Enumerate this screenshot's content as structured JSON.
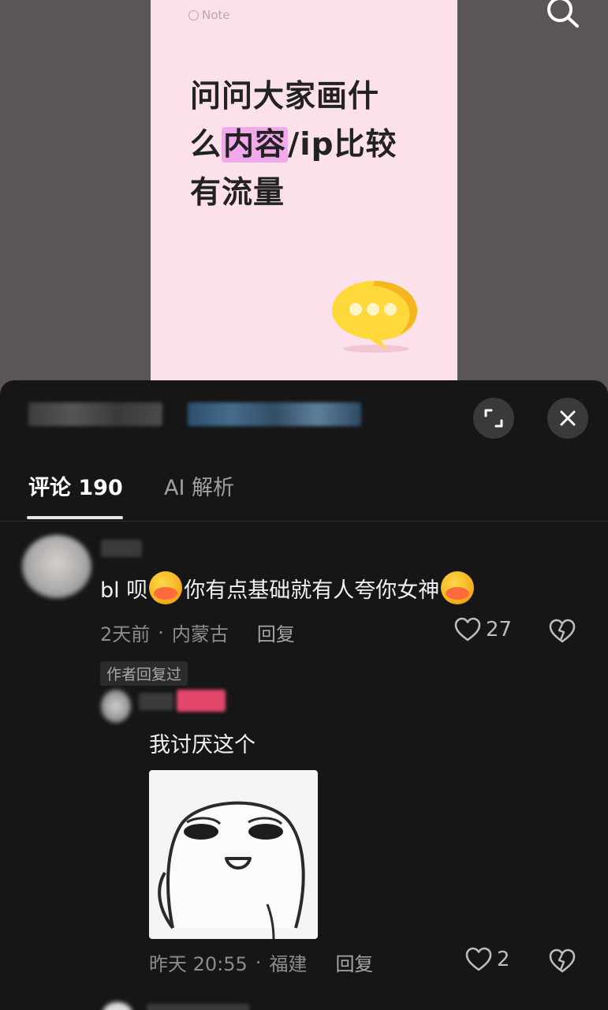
{
  "preview": {
    "note_tag": "Note",
    "title_line1": "问问大家画什",
    "title_line2_pre": "么",
    "title_line2_hl": "内容",
    "title_line2_post": "/ip比较",
    "title_line3": "有流量"
  },
  "tabs": {
    "comments": "评论 190",
    "ai": "AI 解析"
  },
  "comments": [
    {
      "text_1": "bl 呗",
      "text_2": "你有点基础就有人夸你女神",
      "time": "2天前",
      "location": "内蒙古",
      "reply": "回复",
      "likes": "27",
      "author_tag": "作者回复过"
    }
  ],
  "reply": {
    "text": "我讨厌这个",
    "time": "昨天 20:55",
    "location": "福建",
    "reply": "回复",
    "likes": "2"
  },
  "colors": {
    "background": "#161616",
    "card_pink": "#fde1ea",
    "highlight": "#f2a9eb"
  }
}
